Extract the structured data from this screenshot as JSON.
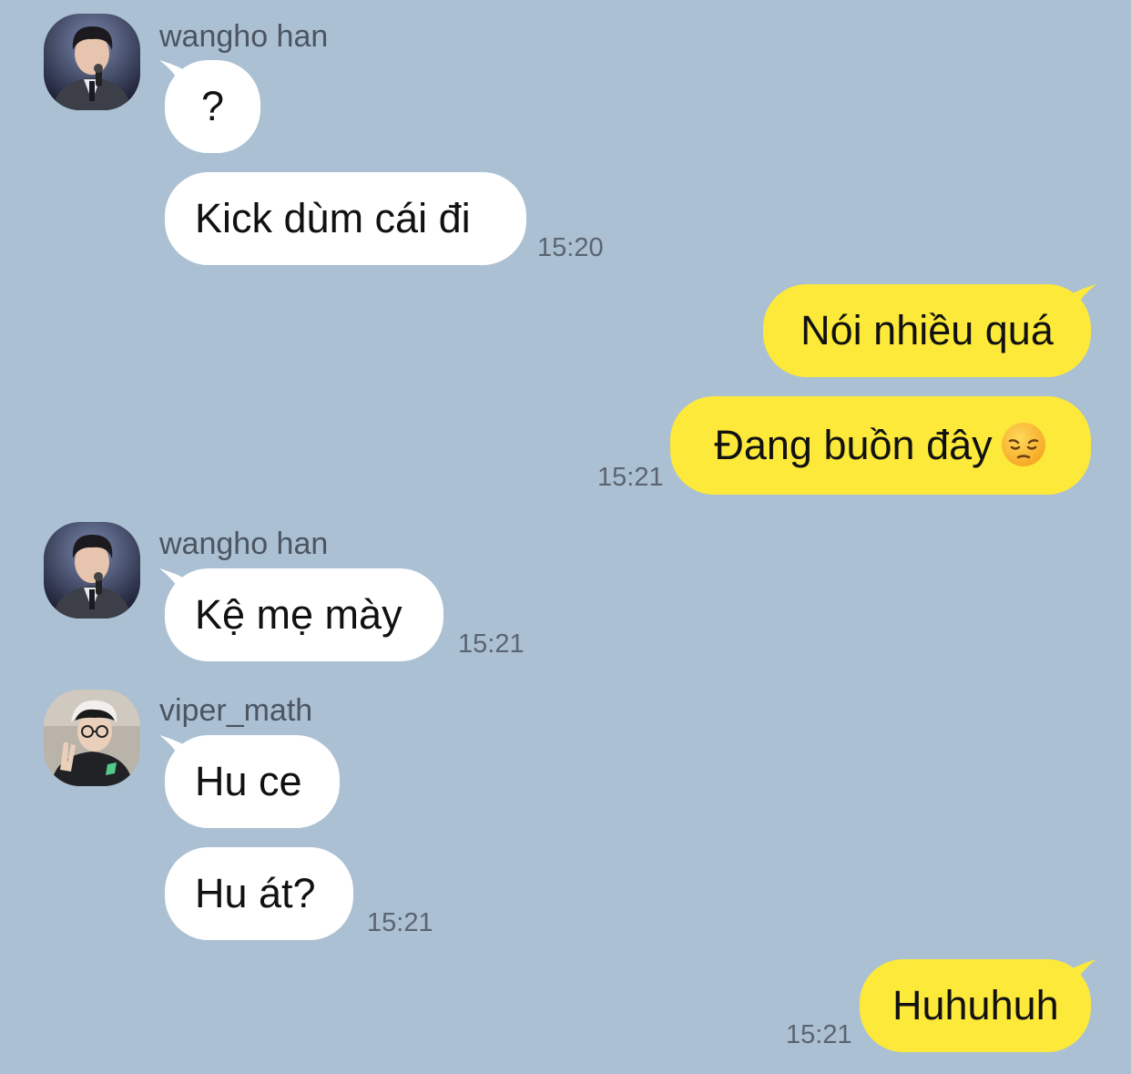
{
  "theme": {
    "background": "#abc0d3",
    "incoming_bubble": "#ffffff",
    "outgoing_bubble": "#fde93a",
    "name_color": "#4c5561",
    "time_color": "#5b6470"
  },
  "messages": [
    {
      "sender": "wangho han",
      "direction": "incoming",
      "text": "?"
    },
    {
      "sender": "wangho han",
      "direction": "incoming",
      "text": "Kick dùm cái đi",
      "time": "15:20"
    },
    {
      "sender": "me",
      "direction": "outgoing",
      "text": "Nói nhiều quá"
    },
    {
      "sender": "me",
      "direction": "outgoing",
      "text": "Đang buồn đây",
      "emoji": "pensive-face-emoji",
      "time": "15:21"
    },
    {
      "sender": "wangho han",
      "direction": "incoming",
      "text": "Kệ mẹ mày",
      "time": "15:21"
    },
    {
      "sender": "viper_math",
      "direction": "incoming",
      "text": "Hu ce"
    },
    {
      "sender": "viper_math",
      "direction": "incoming",
      "text": "Hu át?",
      "time": "15:21"
    },
    {
      "sender": "me",
      "direction": "outgoing",
      "text": "Huhuhuh",
      "time": "15:21"
    }
  ],
  "senders": {
    "wangho": {
      "name": "wangho han",
      "avatar": "avatar-wangho-han"
    },
    "viper": {
      "name": "viper_math",
      "avatar": "avatar-viper-math"
    }
  }
}
